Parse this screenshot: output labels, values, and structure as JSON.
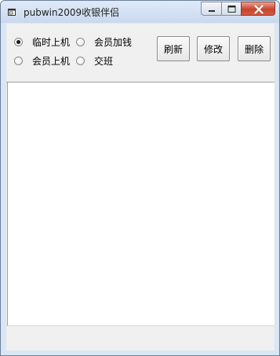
{
  "window": {
    "title": "pubwin2009收银伴侣",
    "icon": "app-window-icon"
  },
  "caption_buttons": {
    "minimize": "minimize-icon",
    "maximize": "maximize-icon",
    "close": "close-icon"
  },
  "options": {
    "radios": [
      {
        "label": "临时上机",
        "checked": true
      },
      {
        "label": "会员加钱",
        "checked": false
      },
      {
        "label": "会员上机",
        "checked": false
      },
      {
        "label": "交班",
        "checked": false
      }
    ]
  },
  "actions": {
    "refresh_label": "刷新",
    "edit_label": "修改",
    "delete_label": "删除"
  },
  "colors": {
    "titlebar": "#c9d9ee",
    "client_bg": "#f0f0f0",
    "close_button": "#c8442e"
  }
}
